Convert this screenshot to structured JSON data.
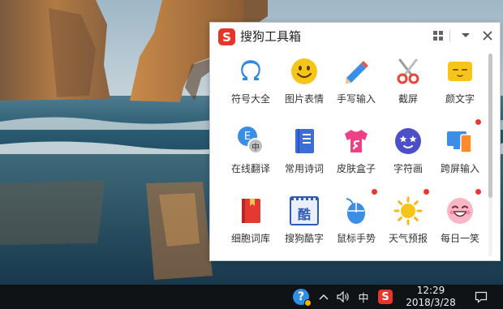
{
  "toolbox": {
    "title": "搜狗工具箱",
    "logo_letter": "S",
    "tools": [
      {
        "label": "符号大全",
        "icon": "omega-symbol-icon",
        "new": false
      },
      {
        "label": "图片表情",
        "icon": "smiley-face-icon",
        "new": false
      },
      {
        "label": "手写输入",
        "icon": "pencil-icon",
        "new": false
      },
      {
        "label": "截屏",
        "icon": "scissors-icon",
        "new": false
      },
      {
        "label": "颜文字",
        "icon": "emoticon-face-icon",
        "new": false
      },
      {
        "label": "在线翻译",
        "icon": "translate-icon",
        "new": false
      },
      {
        "label": "常用诗词",
        "icon": "book-icon",
        "new": false
      },
      {
        "label": "皮肤盒子",
        "icon": "tshirt-icon",
        "new": false
      },
      {
        "label": "字符画",
        "icon": "star-eyes-face-icon",
        "new": false
      },
      {
        "label": "跨屏输入",
        "icon": "phone-screen-icon",
        "new": true
      },
      {
        "label": "细胞词库",
        "icon": "red-book-icon",
        "new": false
      },
      {
        "label": "搜狗酷字",
        "icon": "cool-text-icon",
        "new": false
      },
      {
        "label": "鼠标手势",
        "icon": "mouse-icon",
        "new": true
      },
      {
        "label": "天气预报",
        "icon": "sun-icon",
        "new": true
      },
      {
        "label": "每日一笑",
        "icon": "laughing-face-icon",
        "new": true
      }
    ],
    "translate_badge_e": "E",
    "translate_badge_zh": "中",
    "cool_text_glyph": "酷"
  },
  "taskbar": {
    "help_glyph": "?",
    "ime_mode": "中",
    "sogou_letter": "S",
    "time": "12:29",
    "date": "2018/3/28"
  },
  "colors": {
    "sogou_red": "#e8352a",
    "new_dot": "#e8392b",
    "taskbar_bg": "#0f1316"
  }
}
